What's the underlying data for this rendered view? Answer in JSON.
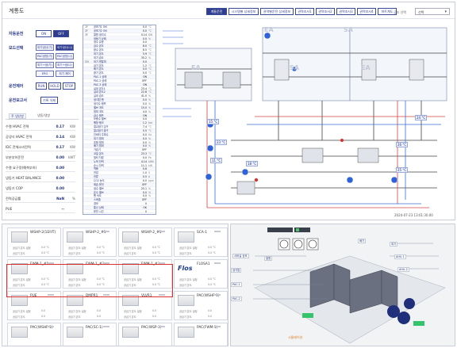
{
  "header": {
    "title": "계통도",
    "tabs": [
      "계통운전",
      "시스템별 상세정보",
      "권역별운전 상세정보",
      "권역조사1",
      "권역조사2",
      "권역조사3",
      "권역조사4",
      "마트계도"
    ],
    "active_tab": 0,
    "select_label": "공조 선택",
    "select_value": "선택"
  },
  "controls": {
    "auto_label": "자동운전",
    "on": "ON",
    "off": "OFF",
    "mode_label": "모드선택",
    "modes": [
      "외기냉난(가)",
      "외기냉난(나)",
      "PAC냉방(가)",
      "PAC냉방(나)",
      "외기+냉(가)",
      "외기+냉(나)",
      "ERG",
      "외기 제어"
    ],
    "op_label": "운전제어",
    "op_buttons": [
      "RUN",
      "HOLD",
      "STOP"
    ],
    "report_label": "운전보고서",
    "report_button": "기록 삭제"
  },
  "stats_tabs": [
    "주 냉난방",
    "냉동/냉방"
  ],
  "stats": [
    {
      "label": "수열 HVAC 전력",
      "value": "0.17",
      "unit": "KW"
    },
    {
      "label": "공냉식 HVAC 전력",
      "value": "0.14",
      "unit": "KW"
    },
    {
      "label": "IDC 전체소비전력",
      "value": "0.17",
      "unit": "KW"
    },
    {
      "label": "부분부하운전",
      "value": "0.00",
      "unit": "kWT"
    },
    {
      "label": "수열 요구량(예측부하)",
      "value": "0.00",
      "unit": ""
    },
    {
      "label": "냉동기 HEAT BALANCE",
      "value": "0.00",
      "unit": ""
    },
    {
      "label": "냉동기 COP",
      "value": "0.00",
      "unit": ""
    },
    {
      "label": "전력공급률",
      "value": "NaN",
      "unit": "%"
    },
    {
      "label": "PUE",
      "value": "--",
      "unit": ""
    }
  ],
  "table": [
    [
      "1F",
      "공조기1 ON",
      "0.0",
      "°C"
    ],
    [
      "2F",
      "공조기2 ON",
      "0.0",
      "°C"
    ],
    [
      "3F",
      "열원 냉각수",
      "0.14",
      "KW"
    ],
    [
      "",
      "냉동기 상태",
      "0.0",
      "%"
    ],
    [
      "",
      "냉수 유량",
      "0.0",
      ""
    ],
    [
      "",
      "급수 온도",
      "8.0",
      "°C"
    ],
    [
      "",
      "환수 온도",
      "6.5",
      "°C"
    ],
    [
      "",
      "외기 온도",
      "5.9",
      "°C"
    ],
    [
      "",
      "외기 습도",
      "35.2",
      "%"
    ],
    [
      "CN",
      "외기 엔탈피",
      "0.0",
      ""
    ],
    [
      "",
      "급기 온도",
      "1.2",
      "°C"
    ],
    [
      "",
      "배기 온도",
      "0.0",
      "°C"
    ],
    [
      "",
      "환기 온도",
      "0.0",
      "°C"
    ],
    [
      "",
      "PAC-1 상태",
      "ON",
      ""
    ],
    [
      "",
      "PAC-2 상태",
      "OFF",
      ""
    ],
    [
      "",
      "PAC-3 상태",
      "ON",
      ""
    ],
    [
      "",
      "실내 온도1",
      "23.4",
      "°C"
    ],
    [
      "",
      "실내 온도2",
      "22.8",
      "°C"
    ],
    [
      "",
      "실내 습도",
      "41.0",
      "%"
    ],
    [
      "",
      "냉각탑 팬",
      "0.0",
      "%"
    ],
    [
      "",
      "냉각수 펌프",
      "0.0",
      "%"
    ],
    [
      "",
      "밸브 개도",
      "15.0",
      "%"
    ],
    [
      "",
      "댐퍼 개도",
      "4.0",
      "%"
    ],
    [
      "",
      "급수 펌프",
      "ON",
      ""
    ],
    [
      "",
      "보충수 밸브",
      "0.0",
      ""
    ],
    [
      "",
      "팽창 탱크",
      "1.2",
      "bar"
    ],
    [
      "",
      "열교환기 입구",
      "7.4",
      "°C"
    ],
    [
      "",
      "열교환기 출구",
      "5.5",
      "°C"
    ],
    [
      "",
      "인버터 주파수",
      "0.0",
      "Hz"
    ],
    [
      "",
      "외기 댐퍼",
      "0.0",
      "%"
    ],
    [
      "",
      "혼합 댐퍼",
      "0.0",
      "%"
    ],
    [
      "",
      "배기 댐퍼",
      "0.0",
      "%"
    ],
    [
      "",
      "가습기",
      "OFF",
      ""
    ],
    [
      "",
      "코일 온도",
      "23.3",
      "°C"
    ],
    [
      "",
      "필터 차압",
      "0.0",
      "Pa"
    ],
    [
      "",
      "누적 전력",
      "4.14",
      "kWh"
    ],
    [
      "",
      "순시 전력",
      "11.1",
      "kW"
    ],
    [
      "",
      "역률",
      "0.6",
      ""
    ],
    [
      "",
      "전압",
      "1.0",
      "V"
    ],
    [
      "",
      "전류",
      "0.5",
      "A"
    ],
    [
      "",
      "CO2 농도",
      "0.0",
      "ppm"
    ],
    [
      "",
      "제습 운전",
      "OFF",
      ""
    ],
    [
      "",
      "냉수 밸브",
      "25.1",
      "%"
    ],
    [
      "",
      "온수 밸브",
      "0.0",
      "%"
    ],
    [
      "",
      "팬 속도",
      "0.0",
      "%"
    ],
    [
      "",
      "스케줄",
      "OFF",
      ""
    ],
    [
      "",
      "경보",
      "0",
      ""
    ],
    [
      "",
      "통신 상태",
      "OK",
      ""
    ],
    [
      "",
      "운전 시간",
      "0",
      ""
    ]
  ],
  "diagram": {
    "zone_labels": [
      "EA",
      "SA",
      "EA",
      "SA",
      "EA"
    ],
    "timestamp": "2024-07-23 13:01:30.00",
    "sensors": [
      "15 °C",
      "23 °C",
      "11 °C",
      "18 °C",
      "26 °C",
      "25 °C",
      "24 °C"
    ]
  },
  "devices": [
    {
      "name": "WSHP-2(1BMT)",
      "l1": "공급기 온도 설정",
      "l2": "공급기 온도",
      "v": "0.0 °C"
    },
    {
      "name": "WSHP-2_#1",
      "l1": "공급기 온도 설정",
      "l2": "공급기 온도",
      "v": "0.0 °C"
    },
    {
      "name": "WSHP-2_#1",
      "l1": "공급기 온도 설정",
      "l2": "공급기 온도",
      "v": "0.0 °C"
    },
    {
      "name": "SCA-1",
      "l1": "공급기 온도 설정",
      "l2": "공급기 온도",
      "v": "0.0 °C"
    },
    {
      "name": "FWM-1_#1",
      "l1": "공급기 온도 설정",
      "l2": "공급기 온도",
      "v": "0.0 °C"
    },
    {
      "name": "FWM-1_#2",
      "l1": "공급기 온도 설정",
      "l2": "공급기 온도",
      "v": "0.0 °C"
    },
    {
      "name": "FWM-1_#3",
      "l1": "공급기 온도 설정",
      "l2": "공급기 온도",
      "v": "0.0 °C"
    },
    {
      "name": "FLOSA1",
      "l1": "공급기 온도 설정",
      "l2": "공급기 온도",
      "v": "0.0 °C"
    },
    {
      "name": "PUE",
      "l1": "공급기 온도 설정",
      "l2": "공급기 온도",
      "v": "0.0"
    },
    {
      "name": "DMPR1",
      "l1": "공급기 온도 설정",
      "l2": "공급기 온도",
      "v": "0.0"
    },
    {
      "name": "VLVR1",
      "l1": "공급기 온도 설정",
      "l2": "공급기 온도",
      "v": "0.0"
    },
    {
      "name": "PAC(WSHP-1)",
      "l1": "공급기 온도 설정",
      "l2": "공급기 온도",
      "v": "0.0"
    },
    {
      "name": "PAC(WSHP-1)",
      "l1": "",
      "l2": "",
      "v": ""
    },
    {
      "name": "PAC(SC-1)",
      "l1": "",
      "l2": "",
      "v": ""
    },
    {
      "name": "PAC(WSP-1)",
      "l1": "",
      "l2": "",
      "v": ""
    },
    {
      "name": "PAC(FWM-1)",
      "l1": "",
      "l2": "",
      "v": ""
    }
  ],
  "brand": "Flos",
  "view3d": {
    "labels": [
      "서버실 공조",
      "냉각탑",
      "PAC-1",
      "PAC-2",
      "외기",
      "AHU-1",
      "AHU-2",
      "열원",
      "배기"
    ],
    "tag": "시뮬레이션"
  },
  "colors": {
    "accent": "#2e3d8f",
    "highlight": "#d93030",
    "pipe_red": "#d14545",
    "pipe_blue": "#3a6fd8"
  }
}
